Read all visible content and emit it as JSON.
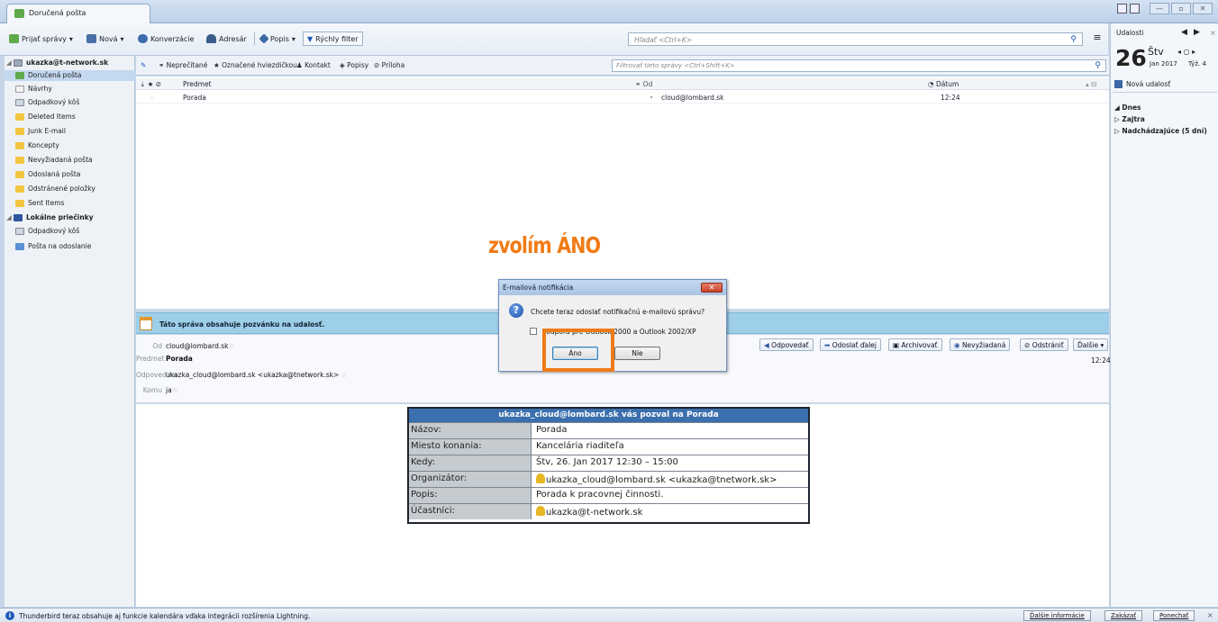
{
  "tabs": [
    {
      "label": "Doručená pošta",
      "icon": "inbox-icon"
    }
  ],
  "toolbar": {
    "get_mail": "Prijať správy",
    "new": "Nová",
    "conversations": "Konverzácie",
    "address_book": "Adresár",
    "tags": "Popis",
    "quick_filter": "Rýchly filter",
    "search_placeholder": "Hľadať <Ctrl+K>"
  },
  "folders": {
    "account": "ukazka@t-network.sk",
    "items": [
      "Doručená pošta",
      "Návrhy",
      "Odpadkový kôš",
      "Deleted Items",
      "Junk E-mail",
      "Koncepty",
      "Nevyžiadaná pošta",
      "Odoslaná pošta",
      "Odstránené položky",
      "Sent Items"
    ],
    "local": "Lokálne priečinky",
    "local_items": [
      "Odpadkový kôš",
      "Pošta na odoslanie"
    ]
  },
  "filterbar": {
    "unread": "Neprečítané",
    "starred": "Označené hviezdičkou",
    "contact": "Kontakt",
    "tags": "Popisy",
    "attachment": "Príloha",
    "placeholder": "Filtrovať tieto správy <Ctrl+Shift+K>"
  },
  "message_list": {
    "columns": [
      "Predmet",
      "Od",
      "Dátum"
    ],
    "rows": [
      {
        "subject": "Porada",
        "from": "cloud@lombard.sk",
        "date": "12:24"
      }
    ]
  },
  "calendar": {
    "title": "Udalosti",
    "day": "26",
    "weekday": "Štv",
    "month_year": "Jan 2017",
    "week": "Týž. 4",
    "new_event": "Nová udalosť",
    "today": "Dnes",
    "tomorrow": "Zajtra",
    "upcoming": "Nadchádzajúce (5 dní)"
  },
  "invite_banner": "Táto správa obsahuje pozvánku na udalosť.",
  "header": {
    "from_label": "Od",
    "from_value": "cloud@lombard.sk",
    "subject_label": "Predmet",
    "subject_value": "Porada",
    "replyto_label": "Odpoveď na",
    "replyto_value": "ukazka_cloud@lombard.sk <ukazka@tnetwork.sk>",
    "to_label": "Komu",
    "to_value": "ja",
    "time": "12:24",
    "actions": [
      "Odpovedať",
      "Odoslať ďalej",
      "Archivovať",
      "Nevyžiadaná",
      "Odstrániť",
      "Ďalšie"
    ]
  },
  "invite": {
    "title": "ukazka_cloud@lombard.sk vás pozval na Porada",
    "rows": [
      {
        "k": "Názov:",
        "v": "Porada"
      },
      {
        "k": "Miesto konania:",
        "v": "Kancelária riaditeľa"
      },
      {
        "k": "Kedy:",
        "v": "Štv, 26. Jan 2017 12:30 – 15:00"
      },
      {
        "k": "Organizátor:",
        "v": "ukazka_cloud@lombard.sk <ukazka@tnetwork.sk>"
      },
      {
        "k": "Popis:",
        "v": "Porada k pracovnej činnosti."
      },
      {
        "k": "Účastníci:",
        "v": "ukazka@t-network.sk"
      }
    ]
  },
  "annotation": "zvolím ÁNO",
  "dialog": {
    "title": "E-mailová notifikácia",
    "message": "Chcete teraz odoslať notifikačnú e-mailovú správu?",
    "checkbox": "Podpora pre Outlook 2000 a Outlook 2002/XP",
    "yes": "Áno",
    "no": "Nie"
  },
  "statusbar": {
    "message": "Thunderbird teraz obsahuje aj funkcie kalendára vďaka integrácii rozšírenia Lightning.",
    "more": "Ďalšie informácie",
    "disable": "Zakázať",
    "keep": "Ponechať"
  },
  "colors": {
    "accent": "#ef7b18",
    "banner": "#9ecfe9",
    "invite_header": "#3b6fad"
  }
}
